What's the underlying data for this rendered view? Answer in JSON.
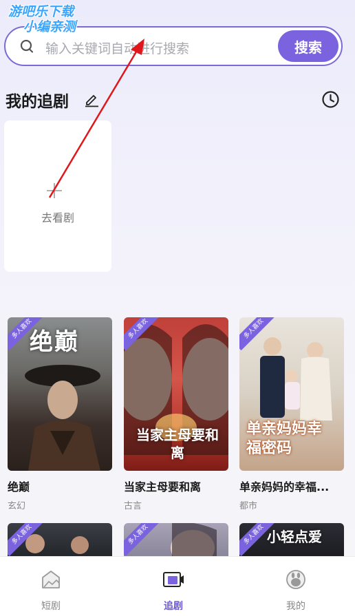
{
  "watermark": {
    "line1": "游吧乐下载",
    "line2": "小编亲测"
  },
  "search": {
    "placeholder": "输入关键词自动进行搜索",
    "button_label": "搜索"
  },
  "my_dramas": {
    "title": "我的追剧",
    "add_label": "去看剧"
  },
  "dramas": [
    {
      "title": "绝巅",
      "genre": "玄幻",
      "badge": "多人喜欢",
      "poster_text": "绝巅"
    },
    {
      "title": "当家主母要和离",
      "genre": "古言",
      "badge": "多人喜欢",
      "poster_text": "当家主母要和离"
    },
    {
      "title": "单亲妈妈的幸福...",
      "genre": "都市",
      "badge": "多人喜欢",
      "poster_text": "单亲妈妈幸福密码"
    }
  ],
  "dramas_row2": [
    {
      "badge": "多人喜欢"
    },
    {
      "badge": "多人喜欢"
    },
    {
      "badge": "多人喜欢",
      "poster_text": "小轻点爱"
    }
  ],
  "tabbar": {
    "items": [
      {
        "label": "短剧",
        "icon": "home-icon",
        "active": false
      },
      {
        "label": "追剧",
        "icon": "video-icon",
        "active": true
      },
      {
        "label": "我的",
        "icon": "profile-icon",
        "active": false
      }
    ]
  },
  "colors": {
    "accent": "#7b63e0",
    "active_tab": "#6c55d8"
  }
}
